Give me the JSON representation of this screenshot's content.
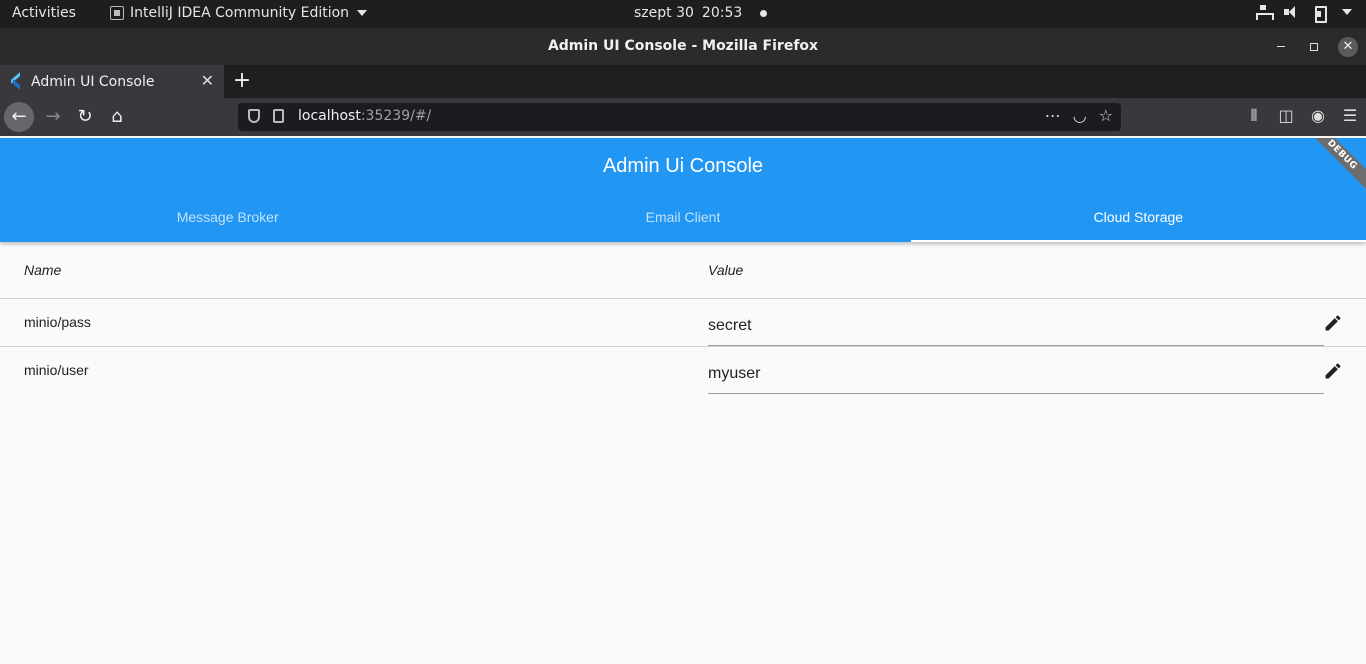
{
  "system_bar": {
    "activities": "Activities",
    "app_name": "IntelliJ IDEA Community Edition",
    "date": "szept 30",
    "time": "20:53"
  },
  "window": {
    "title": "Admin UI Console - Mozilla Firefox",
    "close_glyph": "✕"
  },
  "browser": {
    "tab_title": "Admin UI Console",
    "url_host": "localhost",
    "url_rest": ":35239/#/",
    "icons": [
      "back-icon",
      "forward-icon",
      "reload-icon",
      "home-icon",
      "shield-icon",
      "page-info-icon",
      "more-icon",
      "pocket-icon",
      "bookmark-star-icon",
      "library-icon",
      "sidebar-icon",
      "account-icon",
      "menu-icon"
    ]
  },
  "app": {
    "title": "Admin Ui Console",
    "debug_banner": "DEBUG",
    "accent_color": "#2196f3",
    "tabs": [
      {
        "label": "Message Broker",
        "active": false
      },
      {
        "label": "Email Client",
        "active": false
      },
      {
        "label": "Cloud Storage",
        "active": true
      }
    ]
  },
  "table": {
    "columns": [
      "Name",
      "Value"
    ],
    "rows": [
      {
        "name": "minio/pass",
        "value": "secret"
      },
      {
        "name": "minio/user",
        "value": "myuser"
      }
    ]
  }
}
